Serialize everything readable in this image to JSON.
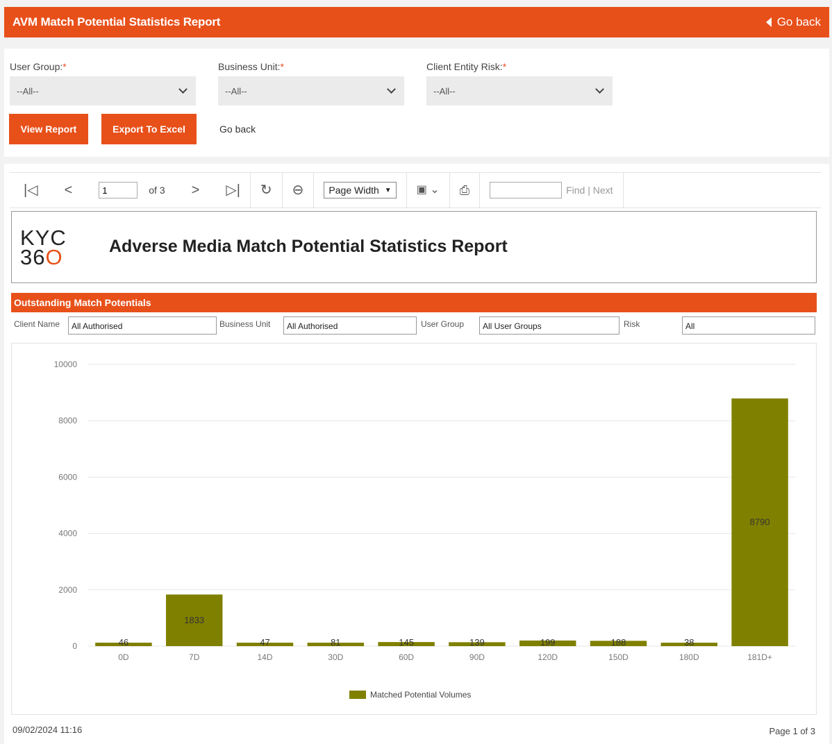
{
  "header": {
    "title": "AVM Match Potential Statistics Report",
    "back_label": "Go back"
  },
  "filters": {
    "user_group": {
      "label": "User Group:",
      "value": "--All--"
    },
    "business_unit": {
      "label": "Business Unit:",
      "value": "--All--"
    },
    "client_entity_risk": {
      "label": "Client Entity Risk:",
      "value": "--All--"
    },
    "required_marker": "*",
    "view_report_label": "View Report",
    "export_label": "Export To Excel",
    "go_back_label": "Go back"
  },
  "toolbar": {
    "page_value": "1",
    "of_label": "of 3",
    "zoom_value": "Page Width",
    "find_label": "Find | Next"
  },
  "report": {
    "logo_line1": "KYC",
    "logo_line2a": "36",
    "logo_line2b": "O",
    "title": "Adverse Media Match Potential Statistics Report",
    "section_title": "Outstanding Match Potentials",
    "params": [
      {
        "label": "Client Name",
        "value": "All Authorised"
      },
      {
        "label": "Business Unit",
        "value": "All Authorised"
      },
      {
        "label": "User Group",
        "value": "All User Groups"
      },
      {
        "label": "Risk",
        "value": "All"
      }
    ],
    "footer_date": "09/02/2024 11:16",
    "footer_page": "Page 1 of 3"
  },
  "colors": {
    "accent": "#e8501a",
    "bar": "#808000"
  },
  "chart_data": {
    "type": "bar",
    "categories": [
      "0D",
      "7D",
      "14D",
      "30D",
      "60D",
      "90D",
      "120D",
      "150D",
      "180D",
      "181D+"
    ],
    "series": [
      {
        "name": "Matched Potential Volumes",
        "values": [
          46,
          1833,
          47,
          81,
          145,
          139,
          199,
          188,
          38,
          8790
        ]
      }
    ],
    "data_labels": [
      "46",
      "1833",
      "47",
      "81",
      "145",
      "139",
      "199",
      "188",
      "38",
      "8790"
    ],
    "yticks": [
      "0",
      "2000",
      "4000",
      "6000",
      "8000",
      "10000"
    ],
    "ylim": [
      0,
      10000
    ],
    "grid": true,
    "legend": "bottom-center"
  }
}
